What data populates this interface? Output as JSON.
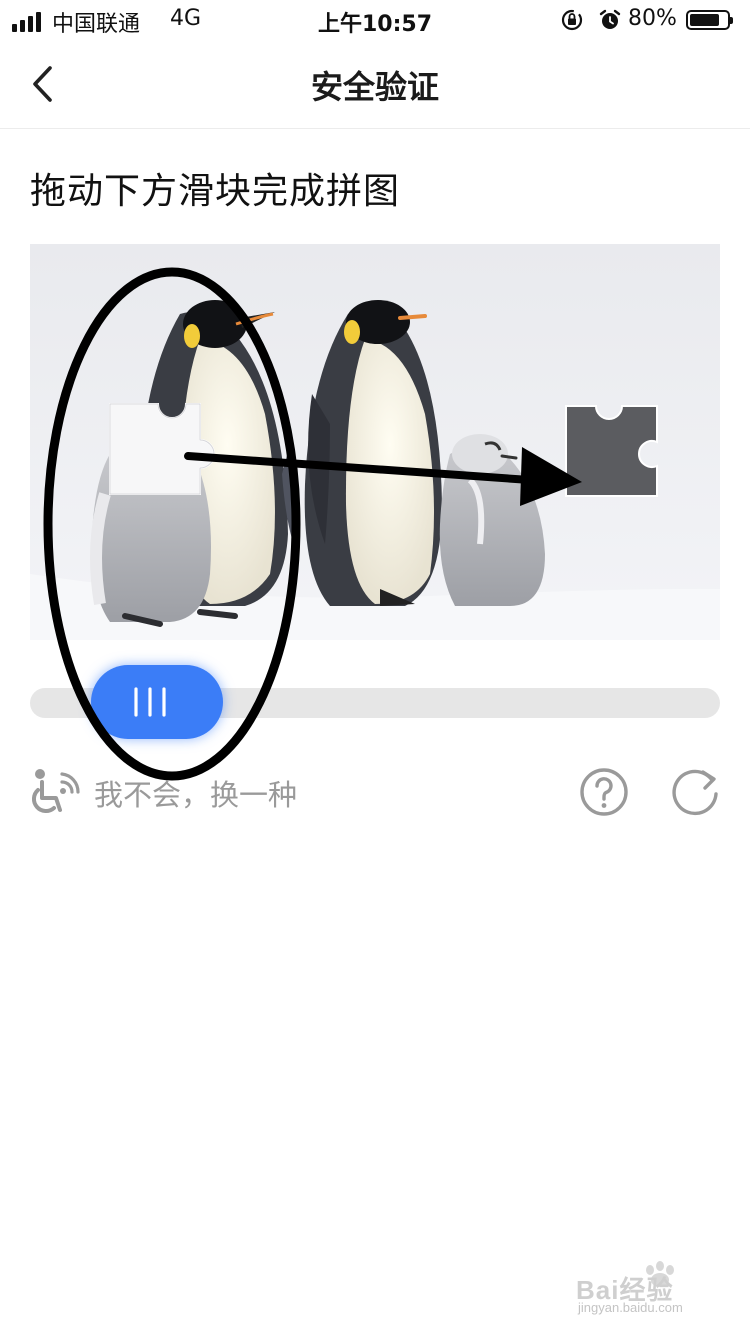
{
  "status_bar": {
    "carrier": "中国联通",
    "network": "4G",
    "time": "上午10:57",
    "battery": "80%",
    "battery_level": 0.8,
    "signal_bars": 4,
    "icons": [
      "orientation-lock-icon",
      "alarm-icon"
    ]
  },
  "nav": {
    "title": "安全验证",
    "back_icon": "chevron-left-icon"
  },
  "instruction": "拖动下方滑块完成拼图",
  "slider": {
    "handle_icon": "grip-lines-icon",
    "accent": "#3b7df7",
    "track_color": "#e6e6e6"
  },
  "footer": {
    "switch_label": "我不会，换一种",
    "accessibility_icon": "accessibility-icon",
    "help_icon": "question-circle-icon",
    "refresh_icon": "refresh-icon"
  },
  "watermark": {
    "brand": "Bai经验",
    "site": "jingyan.baidu.com"
  }
}
